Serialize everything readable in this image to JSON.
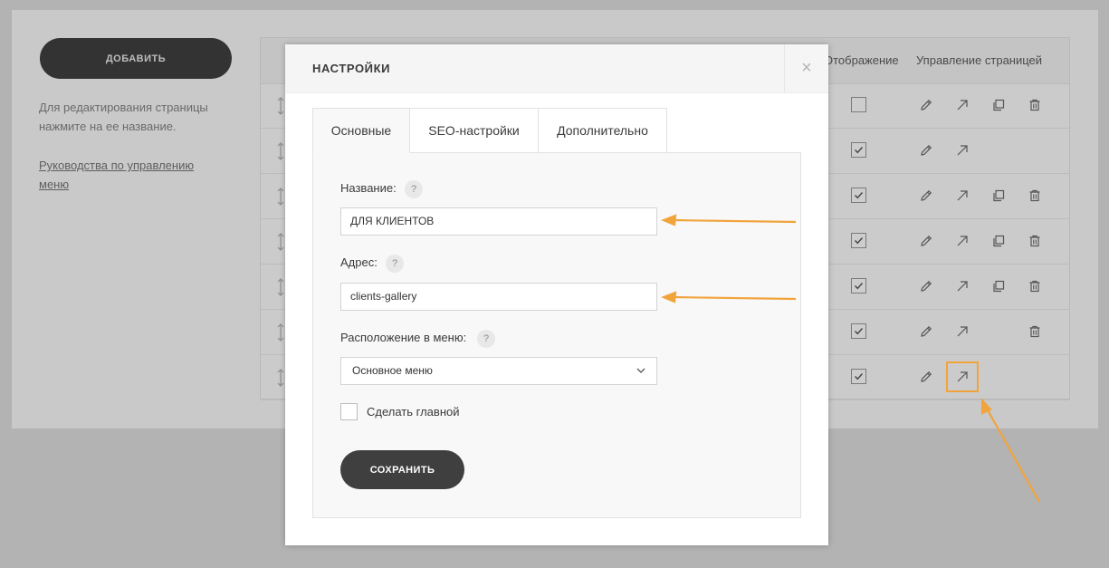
{
  "sidebar": {
    "add_label": "ДОБАВИТЬ",
    "help_text": "Для редактирования страницы нажмите на ее название.",
    "guide_link": "Руководства по управлению меню"
  },
  "table": {
    "columns": {
      "display": "Отображение",
      "manage": "Управление страницей"
    },
    "rows": [
      {
        "visible": false,
        "actions": [
          "edit",
          "open",
          "copy",
          "delete"
        ]
      },
      {
        "visible": true,
        "actions": [
          "edit",
          "open"
        ]
      },
      {
        "visible": true,
        "actions": [
          "edit",
          "open",
          "copy",
          "delete"
        ]
      },
      {
        "visible": true,
        "actions": [
          "edit",
          "open",
          "copy",
          "delete"
        ]
      },
      {
        "visible": true,
        "actions": [
          "edit",
          "open",
          "copy",
          "delete"
        ]
      },
      {
        "visible": true,
        "actions": [
          "edit",
          "open",
          "delete"
        ]
      },
      {
        "visible": true,
        "actions": [
          "edit",
          "open"
        ]
      }
    ]
  },
  "modal": {
    "title": "НАСТРОЙКИ",
    "close_glyph": "×",
    "tabs": [
      {
        "label": "Основные",
        "active": true
      },
      {
        "label": "SEO-настройки",
        "active": false
      },
      {
        "label": "Дополнительно",
        "active": false
      }
    ],
    "help_glyph": "?",
    "fields": {
      "name_label": "Название:",
      "name_value": "ДЛЯ КЛИЕНТОВ",
      "address_label": "Адрес:",
      "address_value": "clients-gallery",
      "menu_label": "Расположение в меню:",
      "menu_value": "Основное меню",
      "main_checkbox_label": "Сделать главной",
      "main_checked": false
    },
    "save_label": "СОХРАНИТЬ"
  },
  "colors": {
    "accent": "#f1a43c",
    "dark_button": "#3f3f3f",
    "overlay": "#b3b3b3"
  },
  "icons": [
    "drag-handle-icon",
    "checkbox",
    "pencil-icon",
    "arrow-up-right-icon",
    "copy-icon",
    "trash-icon",
    "close-icon",
    "chevron-down-icon"
  ]
}
